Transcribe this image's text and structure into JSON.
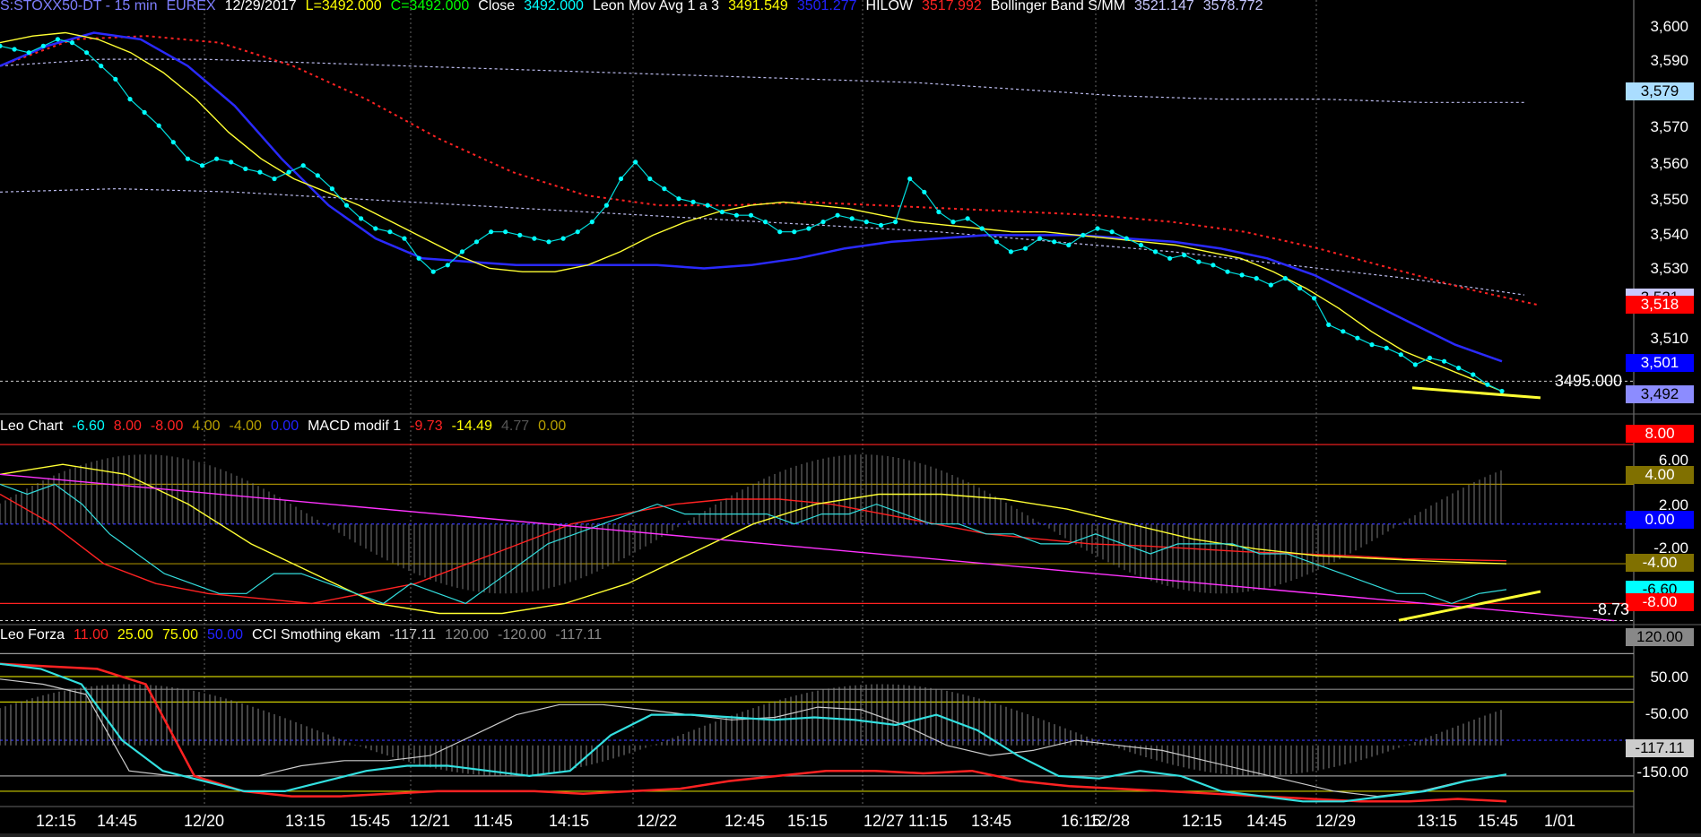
{
  "panes": [
    {
      "legend": [
        {
          "text": "S:STOXX50-DT - 15 min",
          "color": "#7f7fff"
        },
        {
          "text": "EUREX",
          "color": "#7f7fff"
        },
        {
          "text": "12/29/2017",
          "color": "#ffffff"
        },
        {
          "text": "L=3492.000",
          "color": "#ffff00"
        },
        {
          "text": "C=3492.000",
          "color": "#00ff00"
        },
        {
          "text": "Close",
          "color": "#ffffff"
        },
        {
          "text": "3492.000",
          "color": "#00ffff"
        },
        {
          "text": "Leon Mov Avg 1 a 3",
          "color": "#ffffff"
        },
        {
          "text": "3491.549",
          "color": "#ffff00"
        },
        {
          "text": "3501.277",
          "color": "#2222ff"
        },
        {
          "text": "HILOW",
          "color": "#ffffff"
        },
        {
          "text": "3517.992",
          "color": "#ff2222"
        },
        {
          "text": "Bollinger Band S/MM",
          "color": "#ffffff"
        },
        {
          "text": "3521.147",
          "color": "#c8c8ff"
        },
        {
          "text": "3578.772",
          "color": "#c8c8ff"
        }
      ],
      "ticks": [
        "3,600",
        "3,590",
        "3,570",
        "3,560",
        "3,550",
        "3,540",
        "3,530",
        "3,510"
      ],
      "tags": [
        {
          "text": "3,579",
          "bg": "#aaddff",
          "fg": "#000"
        },
        {
          "text": "3,521",
          "bg": "#c8c8ff",
          "fg": "#000"
        },
        {
          "text": "3,518",
          "bg": "#ff0000",
          "fg": "#fff"
        },
        {
          "text": "3,501",
          "bg": "#0000ff",
          "fg": "#fff"
        },
        {
          "text": "3,492",
          "bg": "#8c8cff",
          "fg": "#000"
        }
      ],
      "ref_label": "3495.000"
    },
    {
      "legend": [
        {
          "text": "Leo Chart",
          "color": "#ffffff"
        },
        {
          "text": "-6.60",
          "color": "#00ffff"
        },
        {
          "text": "8.00",
          "color": "#ff2222"
        },
        {
          "text": "-8.00",
          "color": "#ff2222"
        },
        {
          "text": "4.00",
          "color": "#b8a000"
        },
        {
          "text": "-4.00",
          "color": "#b8a000"
        },
        {
          "text": "0.00",
          "color": "#2222ff"
        },
        {
          "text": "MACD modif 1",
          "color": "#ffffff"
        },
        {
          "text": "-9.73",
          "color": "#ff2222"
        },
        {
          "text": "-14.49",
          "color": "#ffff00"
        },
        {
          "text": "4.77",
          "color": "#555555"
        },
        {
          "text": "0.00",
          "color": "#b8a000"
        }
      ],
      "ticks": [
        "6.00",
        "2.00",
        "-2.00",
        "-6.00"
      ],
      "tags": [
        {
          "text": "8.00",
          "bg": "#ff0000",
          "fg": "#fff"
        },
        {
          "text": "4.00",
          "bg": "#807000",
          "fg": "#fff"
        },
        {
          "text": "0.00",
          "bg": "#0000ff",
          "fg": "#fff"
        },
        {
          "text": "-4.00",
          "bg": "#807000",
          "fg": "#fff"
        },
        {
          "text": "-6.60",
          "bg": "#00ffff",
          "fg": "#000"
        },
        {
          "text": "-8.00",
          "bg": "#ff0000",
          "fg": "#fff"
        }
      ],
      "ref_label": "-8.73"
    },
    {
      "legend": [
        {
          "text": "Leo Forza",
          "color": "#ffffff"
        },
        {
          "text": "11.00",
          "color": "#ff2222"
        },
        {
          "text": "25.00",
          "color": "#ffff00"
        },
        {
          "text": "75.00",
          "color": "#ffff00"
        },
        {
          "text": "50.00",
          "color": "#2222ff"
        },
        {
          "text": "CCI Smothing ekam",
          "color": "#ffffff"
        },
        {
          "text": "-117.11",
          "color": "#cccccc"
        },
        {
          "text": "120.00",
          "color": "#888888"
        },
        {
          "text": "-120.00",
          "color": "#888888"
        },
        {
          "text": "-117.11",
          "color": "#888888"
        }
      ],
      "ticks": [
        "50.00",
        "-50.00",
        "-150.00"
      ],
      "tags": [
        {
          "text": "120.00",
          "bg": "#888888",
          "fg": "#000"
        },
        {
          "text": "-117.11",
          "bg": "#cccccc",
          "fg": "#000"
        }
      ]
    }
  ],
  "x_labels": [
    "12:15",
    "14:45",
    "12/20",
    "13:15",
    "15:45",
    "12/21",
    "11:45",
    "14:15",
    "12/22",
    "12:45",
    "15:15",
    "12/27 11:15",
    "13:45",
    "16:15",
    "12/28",
    "12:15",
    "14:45",
    "12/29",
    "13:15",
    "15:45",
    "1/01"
  ],
  "chart_data": {
    "type": "line",
    "title": "S:STOXX50-DT - 15 min",
    "price": {
      "ylim": [
        3487,
        3605
      ],
      "close": [
        3596,
        3595,
        3594,
        3596,
        3598,
        3597,
        3594,
        3590,
        3586,
        3580,
        3576,
        3572,
        3567,
        3562,
        3560,
        3562,
        3561,
        3559,
        3558,
        3556,
        3558,
        3560,
        3557,
        3553,
        3548,
        3544,
        3541,
        3540,
        3538,
        3532,
        3528,
        3530,
        3534,
        3537,
        3540,
        3540,
        3539,
        3538,
        3537,
        3538,
        3540,
        3543,
        3548,
        3556,
        3561,
        3556,
        3553,
        3550,
        3549,
        3548,
        3546,
        3545,
        3545,
        3543,
        3540,
        3540,
        3541,
        3543,
        3545,
        3544,
        3543,
        3542,
        3543,
        3556,
        3552,
        3546,
        3543,
        3544,
        3541,
        3537,
        3534,
        3535,
        3538,
        3537,
        3536,
        3539,
        3541,
        3540,
        3538,
        3536,
        3534,
        3532,
        3533,
        3531,
        3530,
        3528,
        3527,
        3526,
        3524,
        3526,
        3523,
        3520,
        3512,
        3510,
        3508,
        3506,
        3505,
        3503,
        3500,
        3502,
        3501,
        3499,
        3497,
        3494,
        3492
      ],
      "ma_yellow": [
        3597,
        3599,
        3600,
        3598,
        3594,
        3588,
        3580,
        3570,
        3562,
        3556,
        3552,
        3548,
        3543,
        3538,
        3533,
        3529,
        3528,
        3528,
        3530,
        3534,
        3539,
        3543,
        3546,
        3548,
        3549,
        3548,
        3547,
        3545,
        3543,
        3542,
        3541,
        3540,
        3540,
        3539,
        3538,
        3537,
        3536,
        3534,
        3532,
        3528,
        3523,
        3517,
        3510,
        3504,
        3500,
        3496,
        3492
      ],
      "ma_blue": [
        3590,
        3596,
        3600,
        3598,
        3590,
        3578,
        3562,
        3548,
        3538,
        3532,
        3531,
        3530,
        3530,
        3530,
        3530,
        3529,
        3530,
        3532,
        3535,
        3537,
        3538,
        3539,
        3539,
        3539,
        3538,
        3537,
        3535,
        3532,
        3527,
        3520,
        3513,
        3506,
        3501
      ],
      "hilow_red": [
        3590,
        3598,
        3599,
        3597,
        3590,
        3580,
        3568,
        3558,
        3551,
        3548,
        3548,
        3549,
        3548,
        3547,
        3546,
        3545,
        3543,
        3540,
        3535,
        3529,
        3523,
        3518
      ],
      "bb_upper": [
        3590,
        3592,
        3592,
        3591,
        3590,
        3589,
        3588,
        3587,
        3586,
        3585,
        3583,
        3581,
        3580,
        3580,
        3579,
        3579
      ],
      "bb_lower": [
        3552,
        3553,
        3552,
        3550,
        3548,
        3546,
        3544,
        3542,
        3540,
        3537,
        3534,
        3530,
        3526,
        3521
      ],
      "reference": 3495.0
    },
    "macd": {
      "ylim": [
        -9.5,
        9
      ],
      "levels": [
        8,
        4,
        0,
        -4,
        -8
      ],
      "cyan": [
        4,
        3,
        4,
        2,
        -1,
        -3,
        -5,
        -6,
        -7,
        -7,
        -5,
        -5,
        -6,
        -7,
        -8,
        -6,
        -7,
        -8,
        -6,
        -4,
        -2,
        -1,
        0,
        1,
        2,
        1,
        1,
        1,
        1,
        0,
        1,
        1,
        2,
        1,
        0,
        0,
        -1,
        -1,
        -2,
        -2,
        -1,
        -2,
        -3,
        -2,
        -2,
        -2,
        -3,
        -3,
        -4,
        -5,
        -6,
        -7,
        -7,
        -8,
        -7,
        -6.6
      ],
      "red": [
        3,
        0,
        -4,
        -6,
        -7,
        -7.5,
        -8,
        -7,
        -6,
        -4,
        -2,
        0,
        1,
        2,
        2.5,
        2.5,
        2,
        1,
        0,
        -1,
        -1.5,
        -2,
        -2.2,
        -2.5,
        -2.8,
        -3,
        -3.2,
        -3.5,
        -3.6,
        -3.7
      ],
      "yellow": [
        5,
        6,
        5,
        2,
        -2,
        -5,
        -8,
        -9,
        -9,
        -8,
        -6,
        -3,
        0,
        2,
        3,
        3,
        2.5,
        1.5,
        0,
        -1.5,
        -2.5,
        -3.2,
        -3.5,
        -3.8,
        -4
      ],
      "histogram_note": "grey oscillating histogram",
      "trend_magenta": [
        5,
        -9.73
      ]
    },
    "cci": {
      "ylim": [
        -180,
        140
      ],
      "levels": [
        120,
        75,
        50,
        25,
        -50,
        -120,
        -150
      ],
      "cyan": [
        100,
        90,
        60,
        -50,
        -110,
        -130,
        -150,
        -150,
        -130,
        -110,
        -100,
        -100,
        -110,
        -120,
        -110,
        -40,
        0,
        0,
        -5,
        -10,
        -5,
        -10,
        -20,
        0,
        -30,
        -80,
        -120,
        -125,
        -110,
        -120,
        -150,
        -160,
        -170,
        -170,
        -160,
        -150,
        -130,
        -117
      ],
      "red": [
        100,
        95,
        90,
        60,
        -120,
        -150,
        -160,
        -160,
        -155,
        -150,
        -150,
        -150,
        -155,
        -150,
        -145,
        -130,
        -120,
        -110,
        -110,
        -115,
        -110,
        -130,
        -140,
        -145,
        -150,
        -155,
        -160,
        -165,
        -170,
        -170,
        -165,
        -170
      ],
      "grey": [
        70,
        60,
        40,
        -110,
        -120,
        -120,
        -120,
        -100,
        -90,
        -90,
        -80,
        -40,
        0,
        20,
        20,
        10,
        0,
        -10,
        -5,
        15,
        10,
        -20,
        -60,
        -80,
        -70,
        -50,
        -60,
        -70,
        -90,
        -110,
        -130,
        -150,
        -160,
        -150,
        -130,
        -117
      ]
    }
  }
}
